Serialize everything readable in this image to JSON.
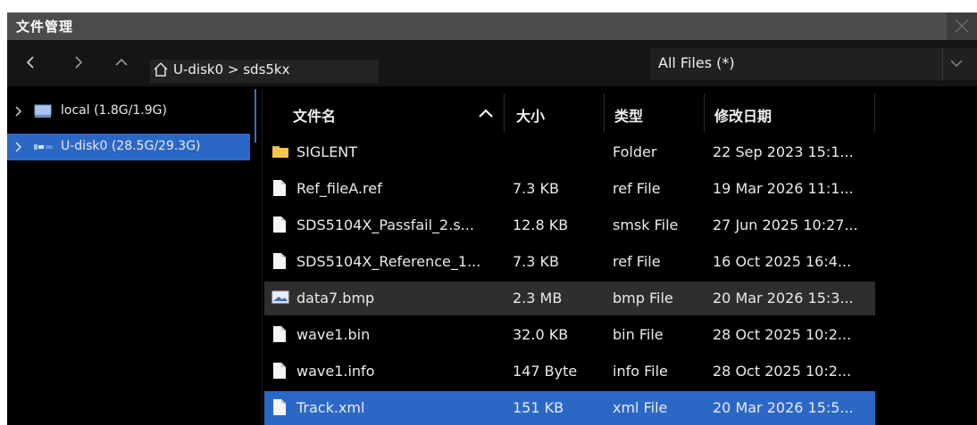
{
  "window": {
    "title": "文件管理"
  },
  "navigation": {
    "back_icon": "chevron-left-icon",
    "forward_icon": "chevron-right-icon",
    "up_icon": "chevron-up-icon",
    "path_icon": "home-icon",
    "path": "U-disk0  > sds5kx"
  },
  "filter": {
    "selected": "All Files (*)"
  },
  "sidebar": {
    "items": [
      {
        "label": "local  (1.8G/1.9G)",
        "icon": "drive-icon",
        "selected": false
      },
      {
        "label": "U-disk0  (28.5G/29.3G)",
        "icon": "usb-drive-icon",
        "selected": true
      }
    ]
  },
  "table": {
    "columns": {
      "name": "文件名",
      "size": "大小",
      "type": "类型",
      "date": "修改日期"
    },
    "rows": [
      {
        "name": "SIGLENT",
        "size": "",
        "type": "Folder",
        "date": "22 Sep 2023 15:1...",
        "icon": "folder-icon",
        "state": "normal"
      },
      {
        "name": "Ref_fileA.ref",
        "size": "7.3 KB",
        "type": "ref File",
        "date": "19 Mar 2026 11:1...",
        "icon": "file-icon",
        "state": "normal"
      },
      {
        "name": "SDS5104X_Passfail_2.s...",
        "size": "12.8 KB",
        "type": "smsk File",
        "date": "27 Jun 2025 10:27...",
        "icon": "file-icon",
        "state": "normal"
      },
      {
        "name": "SDS5104X_Reference_1...",
        "size": "7.3 KB",
        "type": "ref File",
        "date": "16 Oct 2025 16:4...",
        "icon": "file-icon",
        "state": "normal"
      },
      {
        "name": "data7.bmp",
        "size": "2.3 MB",
        "type": "bmp  File",
        "date": "20 Mar 2026  15:3...",
        "icon": "image-icon",
        "state": "hover"
      },
      {
        "name": "wave1.bin",
        "size": "32.0 KB",
        "type": "bin File",
        "date": "28 Oct 2025 10:2...",
        "icon": "file-icon",
        "state": "normal"
      },
      {
        "name": "wave1.info",
        "size": "147 Byte",
        "type": "info File",
        "date": "28 Oct 2025 10:2...",
        "icon": "file-icon",
        "state": "normal"
      },
      {
        "name": "Track.xml",
        "size": "151 KB",
        "type": "xml  File",
        "date": "20 Mar 2026  15:5...",
        "icon": "file-icon",
        "state": "selected"
      }
    ]
  },
  "colors": {
    "selection": "#2b68c6",
    "hover": "#2e2e2e",
    "titlebar": "#4c4c4c",
    "background": "#000000"
  }
}
